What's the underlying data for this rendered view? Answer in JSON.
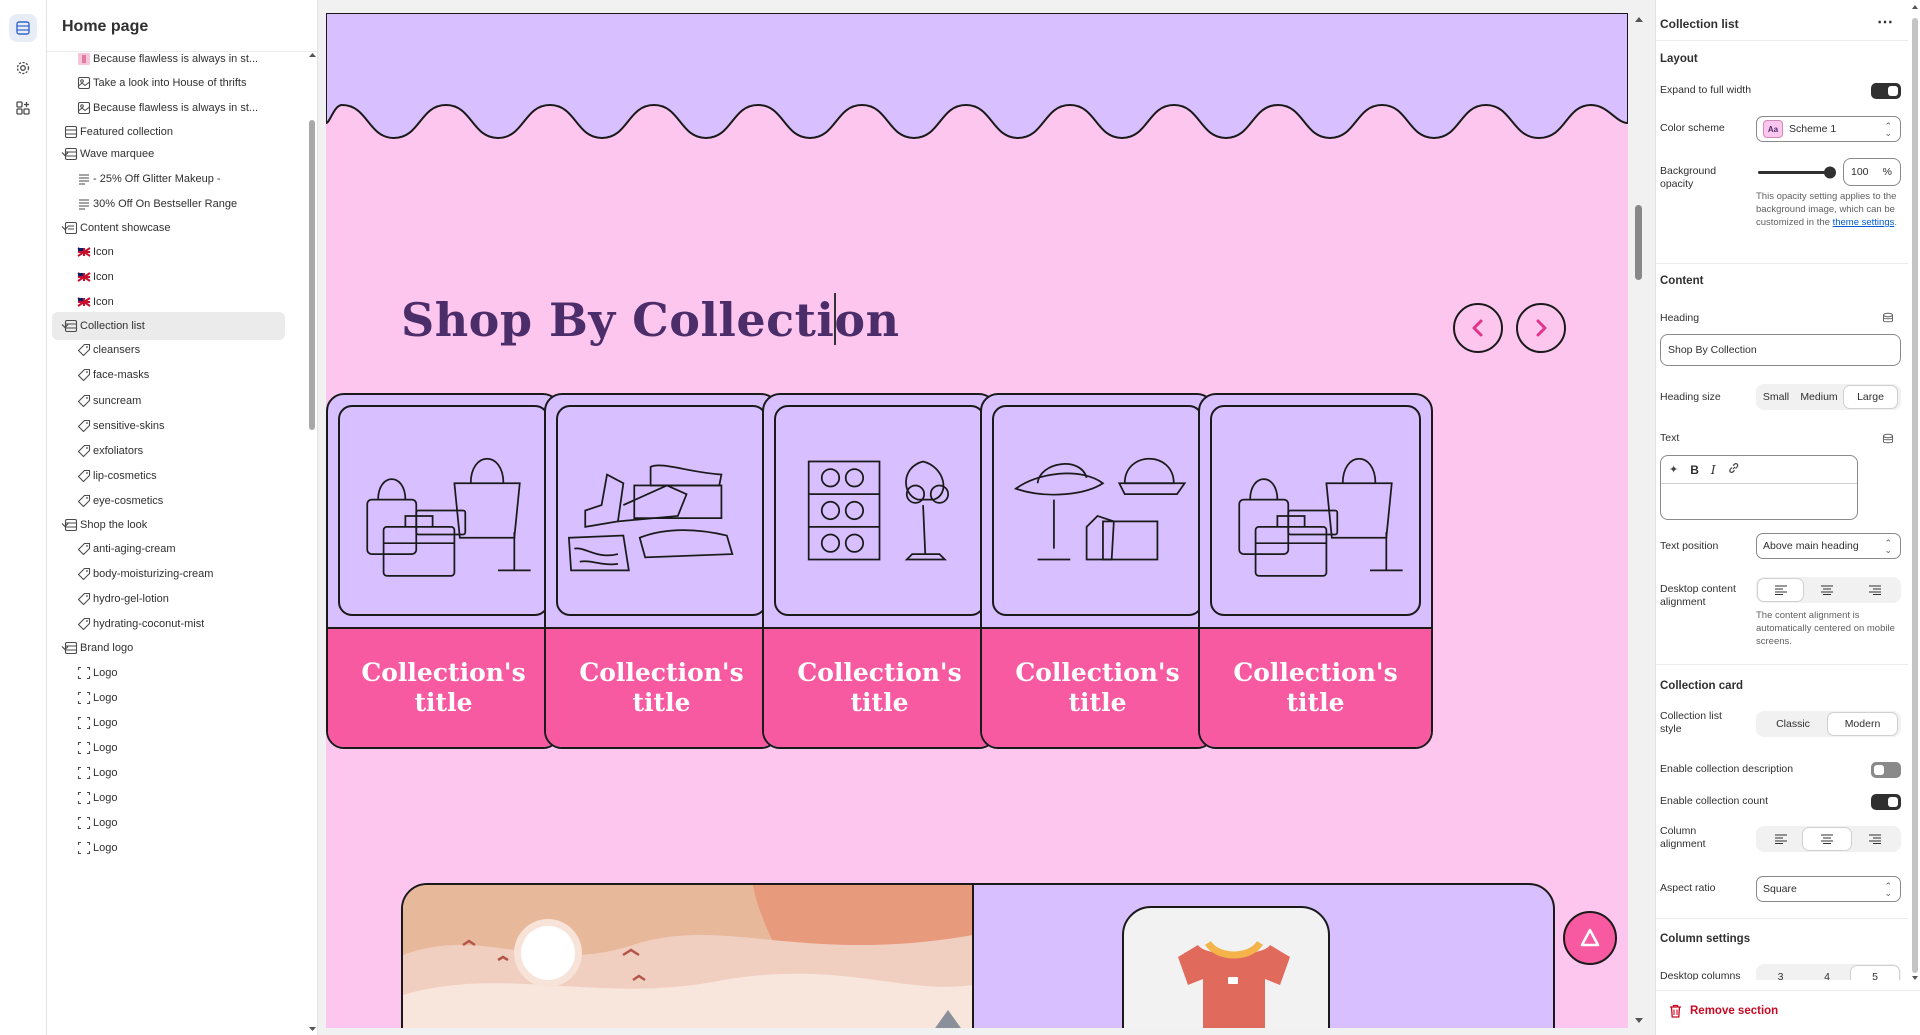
{
  "sidebar": {
    "title": "Home page",
    "items": [
      {
        "label": "Because flawless is always in st...",
        "icon": "image-thumb-icon",
        "indent": 2
      },
      {
        "label": "Take a look into House of thrifts",
        "icon": "image-text-icon",
        "indent": 2
      },
      {
        "label": "Because flawless is always in st...",
        "icon": "image-text-icon",
        "indent": 2
      },
      {
        "label": "Featured collection",
        "icon": "section-icon",
        "indent": 1
      },
      {
        "label": "Wave marquee",
        "icon": "section-icon",
        "indent": 1,
        "expanded": true
      },
      {
        "label": "- 25% Off Glitter Makeup -",
        "icon": "text-lines-icon",
        "indent": 2
      },
      {
        "label": "30% Off On Bestseller Range",
        "icon": "text-lines-icon",
        "indent": 2
      },
      {
        "label": "Content showcase",
        "icon": "showcase-icon",
        "indent": 1,
        "expanded": true
      },
      {
        "label": "Icon",
        "icon": "flag-thumb-icon",
        "indent": 2
      },
      {
        "label": "Icon",
        "icon": "flag-thumb-icon",
        "indent": 2
      },
      {
        "label": "Icon",
        "icon": "flag-thumb-icon",
        "indent": 2
      },
      {
        "label": "Collection list",
        "icon": "section-icon",
        "indent": 1,
        "expanded": true,
        "selected": true
      },
      {
        "label": "cleansers",
        "icon": "tag-icon",
        "indent": 2
      },
      {
        "label": "face-masks",
        "icon": "tag-icon",
        "indent": 2
      },
      {
        "label": "suncream",
        "icon": "tag-icon",
        "indent": 2
      },
      {
        "label": "sensitive-skins",
        "icon": "tag-icon",
        "indent": 2
      },
      {
        "label": "exfoliators",
        "icon": "tag-icon",
        "indent": 2
      },
      {
        "label": "lip-cosmetics",
        "icon": "tag-icon",
        "indent": 2
      },
      {
        "label": "eye-cosmetics",
        "icon": "tag-icon",
        "indent": 2
      },
      {
        "label": "Shop the look",
        "icon": "section-icon",
        "indent": 1,
        "expanded": true
      },
      {
        "label": "anti-aging-cream",
        "icon": "tag-icon",
        "indent": 2
      },
      {
        "label": "body-moisturizing-cream",
        "icon": "tag-icon",
        "indent": 2
      },
      {
        "label": "hydro-gel-lotion",
        "icon": "tag-icon",
        "indent": 2
      },
      {
        "label": "hydrating-coconut-mist",
        "icon": "tag-icon",
        "indent": 2
      },
      {
        "label": "Brand logo",
        "icon": "section-icon",
        "indent": 1,
        "expanded": true
      },
      {
        "label": "Logo",
        "icon": "logo-frame-icon",
        "indent": 2
      },
      {
        "label": "Logo",
        "icon": "logo-frame-icon",
        "indent": 2
      },
      {
        "label": "Logo",
        "icon": "logo-frame-icon",
        "indent": 2
      },
      {
        "label": "Logo",
        "icon": "logo-frame-icon",
        "indent": 2
      },
      {
        "label": "Logo",
        "icon": "logo-frame-icon",
        "indent": 2
      },
      {
        "label": "Logo",
        "icon": "logo-frame-icon",
        "indent": 2
      },
      {
        "label": "Logo",
        "icon": "logo-frame-icon",
        "indent": 2
      },
      {
        "label": "Logo",
        "icon": "logo-frame-icon",
        "indent": 2
      }
    ]
  },
  "preview": {
    "heading": "Shop By Collection",
    "cards": [
      {
        "title": "Collection's title",
        "art": "bags"
      },
      {
        "title": "Collection's title",
        "art": "shoes"
      },
      {
        "title": "Collection's title",
        "art": "glasses"
      },
      {
        "title": "Collection's title",
        "art": "hats"
      },
      {
        "title": "Collection's title",
        "art": "bags"
      }
    ],
    "colors": {
      "background": "#fdc6ee",
      "band": "#d8bfff",
      "accent": "#f75aa0",
      "heading": "#4b2d6a"
    }
  },
  "settings": {
    "title": "Collection list",
    "more": "⋯",
    "layout": {
      "section": "Layout",
      "expand_label": "Expand to full width",
      "expand_on": true,
      "color_scheme_label": "Color scheme",
      "color_scheme_value": "Scheme 1",
      "color_scheme_swatch": "Aa",
      "bg_opacity_label": "Background opacity",
      "bg_opacity_value": "100",
      "bg_opacity_unit": "%",
      "bg_opacity_level": 1.0,
      "help_prefix": "This opacity setting applies to the background image, which can be customized in the ",
      "help_link": "theme settings",
      "help_suffix": "."
    },
    "content": {
      "section": "Content",
      "heading_label": "Heading",
      "heading_value": "Shop By Collection",
      "heading_size_label": "Heading size",
      "heading_sizes": [
        "Small",
        "Medium",
        "Large"
      ],
      "heading_size_selected": 2,
      "text_label": "Text",
      "text_position_label": "Text position",
      "text_position_value": "Above main heading",
      "desktop_alignment_label": "Desktop content alignment",
      "alignment_help": "The content alignment is automatically centered on mobile screens."
    },
    "card": {
      "section": "Collection card",
      "style_label": "Collection list style",
      "styles": [
        "Classic",
        "Modern"
      ],
      "style_selected": 1,
      "desc_label": "Enable collection description",
      "desc_on": false,
      "count_label": "Enable collection count",
      "count_on": true,
      "col_align_label": "Column alignment",
      "aspect_label": "Aspect ratio",
      "aspect_value": "Square"
    },
    "columns": {
      "section": "Column settings",
      "desktop_label": "Desktop columns",
      "options": [
        "3",
        "4",
        "5"
      ],
      "selected": 2
    },
    "remove_label": "Remove section"
  }
}
